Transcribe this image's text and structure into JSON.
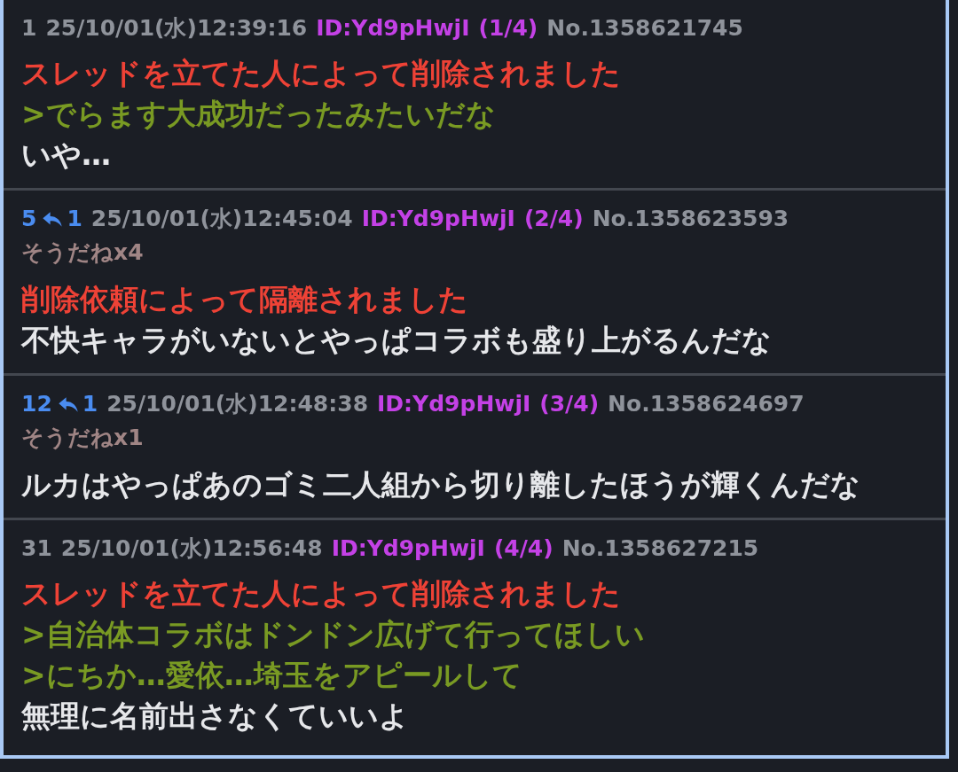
{
  "posts": [
    {
      "number": "1",
      "date": "25/10/01(水)12:39:16",
      "id": "ID:Yd9pHwjI",
      "count": "(1/4)",
      "no": "No.1358621745",
      "lines": [
        {
          "kind": "deleted",
          "text": "スレッドを立てた人によって削除されました"
        },
        {
          "kind": "quote",
          "text": ">でらます大成功だったみたいだな"
        },
        {
          "kind": "text",
          "text": "いや…"
        }
      ]
    },
    {
      "number": "5",
      "replies": "1",
      "date": "25/10/01(水)12:45:04",
      "id": "ID:Yd9pHwjI",
      "count": "(2/4)",
      "no": "No.1358623593",
      "soudane": "そうだねx4",
      "lines": [
        {
          "kind": "deleted",
          "text": "削除依頼によって隔離されました"
        },
        {
          "kind": "text",
          "text": "不快キャラがいないとやっぱコラボも盛り上がるんだな"
        }
      ]
    },
    {
      "number": "12",
      "replies": "1",
      "date": "25/10/01(水)12:48:38",
      "id": "ID:Yd9pHwjI",
      "count": "(3/4)",
      "no": "No.1358624697",
      "soudane": "そうだねx1",
      "lines": [
        {
          "kind": "text",
          "text": "ルカはやっぱあのゴミ二人組から切り離したほうが輝くんだな"
        }
      ]
    },
    {
      "number": "31",
      "date": "25/10/01(水)12:56:48",
      "id": "ID:Yd9pHwjI",
      "count": "(4/4)",
      "no": "No.1358627215",
      "lines": [
        {
          "kind": "deleted",
          "text": "スレッドを立てた人によって削除されました"
        },
        {
          "kind": "quote",
          "text": ">自治体コラボはドンドン広げて行ってほしい"
        },
        {
          "kind": "quote",
          "text": ">にちか…愛依…埼玉をアピールして"
        },
        {
          "kind": "text",
          "text": "無理に名前出さなくていいよ"
        }
      ]
    }
  ]
}
